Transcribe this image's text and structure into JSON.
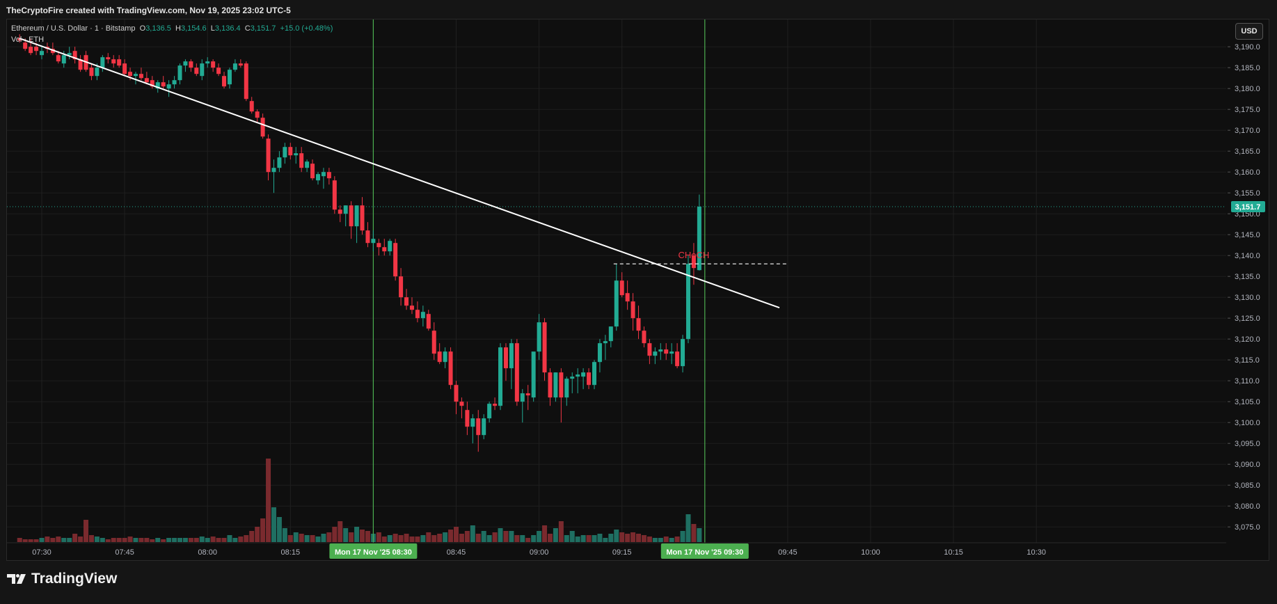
{
  "header": {
    "title": "TheCryptoFire created with TradingView.com, Nov 19, 2025 23:02 UTC-5"
  },
  "legend": {
    "symbol": "Ethereum / U.S. Dollar · 1 · Bitstamp",
    "o_label": "O",
    "o_value": "3,136.5",
    "h_label": "H",
    "h_value": "3,154.6",
    "l_label": "L",
    "l_value": "3,136.4",
    "c_label": "C",
    "c_value": "3,151.7",
    "change": "+15.0 (+0.48%)",
    "volume_label": "Vol · ETH"
  },
  "currency_button": "USD",
  "footer": {
    "brand": "TradingView"
  },
  "colors": {
    "up": "#22ab94",
    "down": "#f23645",
    "vline": "#4caf50",
    "choch": "#f23645",
    "trendline": "#ffffff",
    "grid": "#1f1f1f"
  },
  "chart_data": {
    "type": "candlestick",
    "symbol": "ETH/USD",
    "timeframe_minutes": 1,
    "ylim": [
      3071,
      3193
    ],
    "price_ticks": [
      "3,075.0",
      "3,080.0",
      "3,085.0",
      "3,090.0",
      "3,095.0",
      "3,100.0",
      "3,105.0",
      "3,110.0",
      "3,115.0",
      "3,120.0",
      "3,125.0",
      "3,130.0",
      "3,135.0",
      "3,140.0",
      "3,145.0",
      "3,150.0",
      "3,155.0",
      "3,160.0",
      "3,165.0",
      "3,170.0",
      "3,175.0",
      "3,180.0",
      "3,185.0",
      "3,190.0"
    ],
    "time_ticks": [
      {
        "label": "07:30",
        "minute": 0
      },
      {
        "label": "07:45",
        "minute": 15
      },
      {
        "label": "08:00",
        "minute": 30
      },
      {
        "label": "08:15",
        "minute": 45
      },
      {
        "label": "08:45",
        "minute": 75
      },
      {
        "label": "09:00",
        "minute": 90
      },
      {
        "label": "09:15",
        "minute": 105
      },
      {
        "label": "09:45",
        "minute": 135
      },
      {
        "label": "10:00",
        "minute": 150
      },
      {
        "label": "10:15",
        "minute": 165
      },
      {
        "label": "10:30",
        "minute": 180
      }
    ],
    "time_highlights": [
      {
        "label": "Mon 17 Nov '25   08:30",
        "minute": 60
      },
      {
        "label": "Mon 17 Nov '25   09:30",
        "minute": 120
      }
    ],
    "last_price": 3151.7,
    "last_price_label": "3,151.7",
    "trendline": {
      "x1": -4,
      "y1": 3192,
      "x2": 133.5,
      "y2": 3127.5
    },
    "choch": {
      "label": "CHoCH",
      "price": 3138,
      "x_start": 103.5,
      "x_end": 135,
      "label_x": 118
    },
    "candles": [
      [
        3192,
        3193,
        3191,
        3191.5,
        3
      ],
      [
        3191,
        3192,
        3189,
        3189.5,
        2
      ],
      [
        3190,
        3192,
        3188,
        3188.5,
        2
      ],
      [
        3190,
        3191,
        3188,
        3189,
        2
      ],
      [
        3188,
        3190,
        3187,
        3189,
        3
      ],
      [
        3190,
        3191,
        3188.5,
        3189.5,
        4
      ],
      [
        3189.5,
        3191,
        3188,
        3188.5,
        3
      ],
      [
        3188,
        3189,
        3186,
        3186.5,
        4
      ],
      [
        3186,
        3189,
        3185,
        3188,
        3
      ],
      [
        3188,
        3190,
        3187,
        3188.5,
        3
      ],
      [
        3189,
        3190,
        3186,
        3187,
        6
      ],
      [
        3187,
        3188,
        3184,
        3184.5,
        4
      ],
      [
        3188,
        3189,
        3184,
        3184.5,
        16
      ],
      [
        3185,
        3186,
        3182,
        3183,
        5
      ],
      [
        3183,
        3186,
        3182,
        3185,
        4
      ],
      [
        3185,
        3188,
        3184,
        3187.5,
        3
      ],
      [
        3187.5,
        3188.5,
        3186,
        3187,
        2
      ],
      [
        3187,
        3188,
        3185,
        3186,
        3
      ],
      [
        3187,
        3188,
        3185,
        3185.5,
        3
      ],
      [
        3186,
        3187,
        3183,
        3183.5,
        3
      ],
      [
        3184,
        3185,
        3182,
        3183,
        4
      ],
      [
        3183,
        3184,
        3181,
        3183.5,
        3
      ],
      [
        3183.5,
        3185,
        3182,
        3182.5,
        3
      ],
      [
        3182.5,
        3184,
        3181,
        3181.5,
        3
      ],
      [
        3182,
        3183,
        3180,
        3180.5,
        2
      ],
      [
        3180,
        3182,
        3179,
        3181.5,
        3
      ],
      [
        3181.5,
        3183,
        3180,
        3180.5,
        2
      ],
      [
        3180,
        3182,
        3178,
        3181,
        3
      ],
      [
        3181,
        3183,
        3180,
        3182,
        3
      ],
      [
        3182,
        3186,
        3181,
        3185.5,
        3
      ],
      [
        3185.5,
        3187,
        3184,
        3186.5,
        3
      ],
      [
        3186.5,
        3187,
        3184,
        3185,
        3
      ],
      [
        3185,
        3186,
        3183,
        3183.5,
        3
      ],
      [
        3183,
        3187,
        3182,
        3186,
        4
      ],
      [
        3186,
        3187.5,
        3185,
        3186.5,
        3
      ],
      [
        3186.5,
        3187,
        3184,
        3185,
        4
      ],
      [
        3185,
        3186,
        3183,
        3183.5,
        3
      ],
      [
        3183,
        3184,
        3180,
        3180.5,
        3
      ],
      [
        3181,
        3185,
        3180,
        3184.5,
        5
      ],
      [
        3184.5,
        3187,
        3184,
        3186,
        3
      ],
      [
        3186,
        3187,
        3185,
        3185.5,
        4
      ],
      [
        3186,
        3186.5,
        3177,
        3177.5,
        5
      ],
      [
        3177,
        3178,
        3174,
        3174.5,
        8
      ],
      [
        3174.5,
        3175,
        3172,
        3173,
        11
      ],
      [
        3173,
        3174,
        3168,
        3168.5,
        17
      ],
      [
        3168,
        3169,
        3158,
        3160,
        60
      ],
      [
        3160,
        3163,
        3155,
        3161,
        25
      ],
      [
        3161,
        3165,
        3160,
        3163.5,
        18
      ],
      [
        3163.5,
        3167,
        3162,
        3166,
        10
      ],
      [
        3166,
        3167,
        3163,
        3164,
        5
      ],
      [
        3164,
        3166,
        3162,
        3164.5,
        7
      ],
      [
        3164.5,
        3166,
        3160,
        3161,
        6
      ],
      [
        3161,
        3163,
        3160,
        3162.5,
        5
      ],
      [
        3162,
        3163,
        3158,
        3158.5,
        5
      ],
      [
        3158,
        3160,
        3157,
        3159.5,
        4
      ],
      [
        3159,
        3161,
        3156,
        3160,
        6
      ],
      [
        3160,
        3161,
        3157,
        3158.5,
        7
      ],
      [
        3158,
        3159,
        3150,
        3151,
        11
      ],
      [
        3151,
        3152,
        3148,
        3150,
        15
      ],
      [
        3150,
        3152,
        3147,
        3152,
        10
      ],
      [
        3152,
        3153,
        3144,
        3147,
        7
      ],
      [
        3147,
        3152,
        3143,
        3152,
        11
      ],
      [
        3152,
        3154,
        3145,
        3146,
        9
      ],
      [
        3146,
        3148,
        3142,
        3143,
        8
      ],
      [
        3143,
        3146,
        3141,
        3144,
        6
      ],
      [
        3143,
        3144,
        3140,
        3142,
        7
      ],
      [
        3142,
        3144,
        3140,
        3141,
        4
      ],
      [
        3141,
        3144,
        3140,
        3143.5,
        5
      ],
      [
        3143,
        3144,
        3134,
        3135,
        6
      ],
      [
        3135,
        3137,
        3128,
        3130,
        5
      ],
      [
        3130,
        3132,
        3127,
        3128,
        6
      ],
      [
        3128,
        3130,
        3126,
        3127,
        4
      ],
      [
        3127,
        3129,
        3124,
        3125,
        4
      ],
      [
        3125,
        3128,
        3123,
        3126.5,
        5
      ],
      [
        3126,
        3127,
        3122,
        3122.5,
        7
      ],
      [
        3122,
        3124,
        3115,
        3116.5,
        5
      ],
      [
        3117,
        3119,
        3114,
        3114.5,
        6
      ],
      [
        3114.5,
        3118,
        3113,
        3117,
        7
      ],
      [
        3117,
        3118,
        3108,
        3109,
        9
      ],
      [
        3109,
        3110,
        3102,
        3105,
        11
      ],
      [
        3105,
        3106,
        3101,
        3104,
        6
      ],
      [
        3103,
        3105,
        3097,
        3099,
        8
      ],
      [
        3099,
        3102,
        3095,
        3101,
        12
      ],
      [
        3101,
        3103,
        3093,
        3097,
        6
      ],
      [
        3097,
        3102,
        3096,
        3101,
        8
      ],
      [
        3101,
        3105,
        3100,
        3104.5,
        5
      ],
      [
        3104.5,
        3106,
        3103,
        3104,
        7
      ],
      [
        3104,
        3119,
        3103,
        3118,
        10
      ],
      [
        3118,
        3119,
        3110,
        3113,
        8
      ],
      [
        3113,
        3120,
        3108,
        3119,
        8
      ],
      [
        3119,
        3120,
        3104,
        3105,
        5
      ],
      [
        3105,
        3108,
        3100,
        3107,
        5
      ],
      [
        3107,
        3109,
        3103,
        3106.5,
        3
      ],
      [
        3106,
        3115,
        3105,
        3117,
        5
      ],
      [
        3117,
        3126,
        3115,
        3124,
        8
      ],
      [
        3124,
        3125,
        3110,
        3112,
        12
      ],
      [
        3112,
        3113,
        3104,
        3106,
        6
      ],
      [
        3106,
        3112,
        3105,
        3112,
        10
      ],
      [
        3112,
        3113,
        3100,
        3106,
        15
      ],
      [
        3106,
        3111,
        3104,
        3110.5,
        5
      ],
      [
        3110.5,
        3112,
        3107,
        3111,
        8
      ],
      [
        3111,
        3113,
        3107,
        3111.5,
        4
      ],
      [
        3111,
        3113,
        3108,
        3112,
        5
      ],
      [
        3112,
        3113,
        3108,
        3109,
        5
      ],
      [
        3109,
        3115,
        3108,
        3114.5,
        5
      ],
      [
        3114.5,
        3120,
        3112,
        3119,
        6
      ],
      [
        3119,
        3121,
        3115,
        3119.5,
        3
      ],
      [
        3119.5,
        3123,
        3118,
        3123,
        6
      ],
      [
        3123,
        3138,
        3122,
        3134,
        9
      ],
      [
        3134,
        3136,
        3130,
        3130.5,
        7
      ],
      [
        3131,
        3134,
        3127,
        3129,
        6
      ],
      [
        3129,
        3131,
        3122,
        3125,
        7
      ],
      [
        3125,
        3128,
        3120,
        3122,
        6
      ],
      [
        3122,
        3123,
        3118,
        3119,
        5
      ],
      [
        3119,
        3120,
        3114,
        3116,
        4
      ],
      [
        3116,
        3118,
        3114,
        3117,
        3
      ],
      [
        3117,
        3119,
        3115,
        3117.5,
        3
      ],
      [
        3117.5,
        3119,
        3115,
        3116.5,
        4
      ],
      [
        3116.5,
        3119,
        3114,
        3117,
        3
      ],
      [
        3117,
        3119,
        3113,
        3113.5,
        4
      ],
      [
        3113.5,
        3121,
        3112,
        3120,
        8
      ],
      [
        3120,
        3140,
        3119,
        3138,
        20
      ],
      [
        3140,
        3143,
        3133,
        3137,
        13
      ],
      [
        3136.5,
        3154.6,
        3136.4,
        3151.7,
        10
      ]
    ],
    "volume_note": "Volume bars shown in relative units"
  }
}
